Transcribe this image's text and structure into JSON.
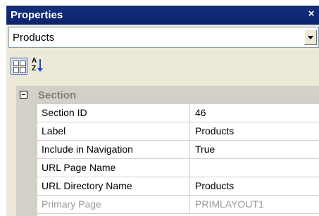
{
  "window": {
    "title": "Properties",
    "close_glyph": "×"
  },
  "selector": {
    "value": "Products"
  },
  "toolbar": {
    "categorized_icon": "categorized-view-icon",
    "alphabetical_icon": "alphabetical-sort-icon",
    "alpha_top": "A",
    "alpha_bottom": "Z"
  },
  "grid": {
    "category": {
      "label": "Section",
      "expanded": true
    },
    "properties": [
      {
        "name": "Section ID",
        "value": "46"
      },
      {
        "name": "Label",
        "value": "Products"
      },
      {
        "name": "Include in Navigation",
        "value": "True"
      },
      {
        "name": "URL Page Name",
        "value": ""
      },
      {
        "name": "URL Directory Name",
        "value": "Products"
      },
      {
        "name": "Primary Page",
        "value": "PRIMLAYOUT1"
      }
    ]
  }
}
